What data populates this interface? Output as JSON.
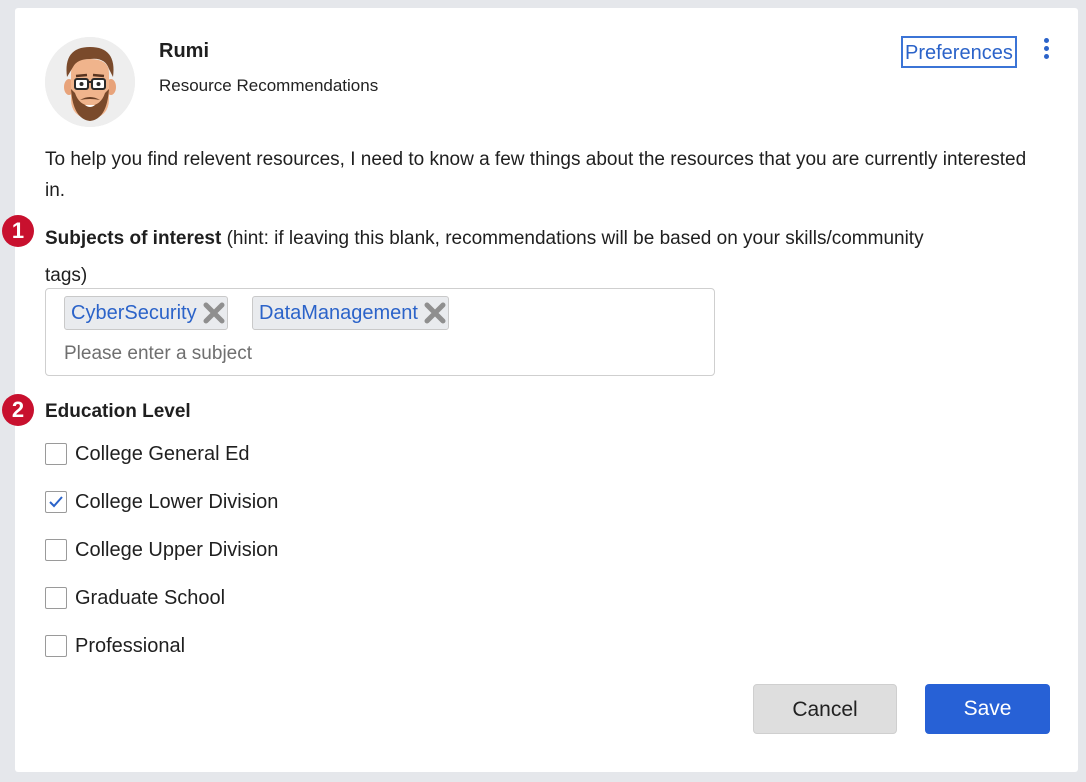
{
  "header": {
    "bot_name": "Rumi",
    "bot_subtitle": "Resource Recommendations",
    "preferences_link": "Preferences",
    "more_menu_icon": "vertical-ellipsis-icon"
  },
  "intro_text": "To help you find relevent resources, I need to know a few things about the resources that you are currently interested in.",
  "steps": {
    "step1": "1",
    "step2": "2"
  },
  "subjects": {
    "label_bold": "Subjects of interest",
    "label_hint": " (hint: if leaving this blank, recommendations will be based on your skills/community tags)",
    "tags": [
      {
        "label": "CyberSecurity",
        "remove_icon": "close-icon"
      },
      {
        "label": "DataManagement",
        "remove_icon": "close-icon"
      }
    ],
    "input_value": "",
    "input_placeholder": "Please enter a subject"
  },
  "education": {
    "label": "Education Level",
    "options": [
      {
        "label": "College General Ed",
        "checked": false
      },
      {
        "label": "College Lower Division",
        "checked": true
      },
      {
        "label": "College Upper Division",
        "checked": false
      },
      {
        "label": "Graduate School",
        "checked": false
      },
      {
        "label": "Professional",
        "checked": false
      }
    ]
  },
  "buttons": {
    "cancel": "Cancel",
    "save": "Save"
  },
  "colors": {
    "accent": "#2b63c9",
    "save_button": "#2761d6",
    "step_badge": "#c8102e",
    "page_background": "#e5e7eb"
  }
}
